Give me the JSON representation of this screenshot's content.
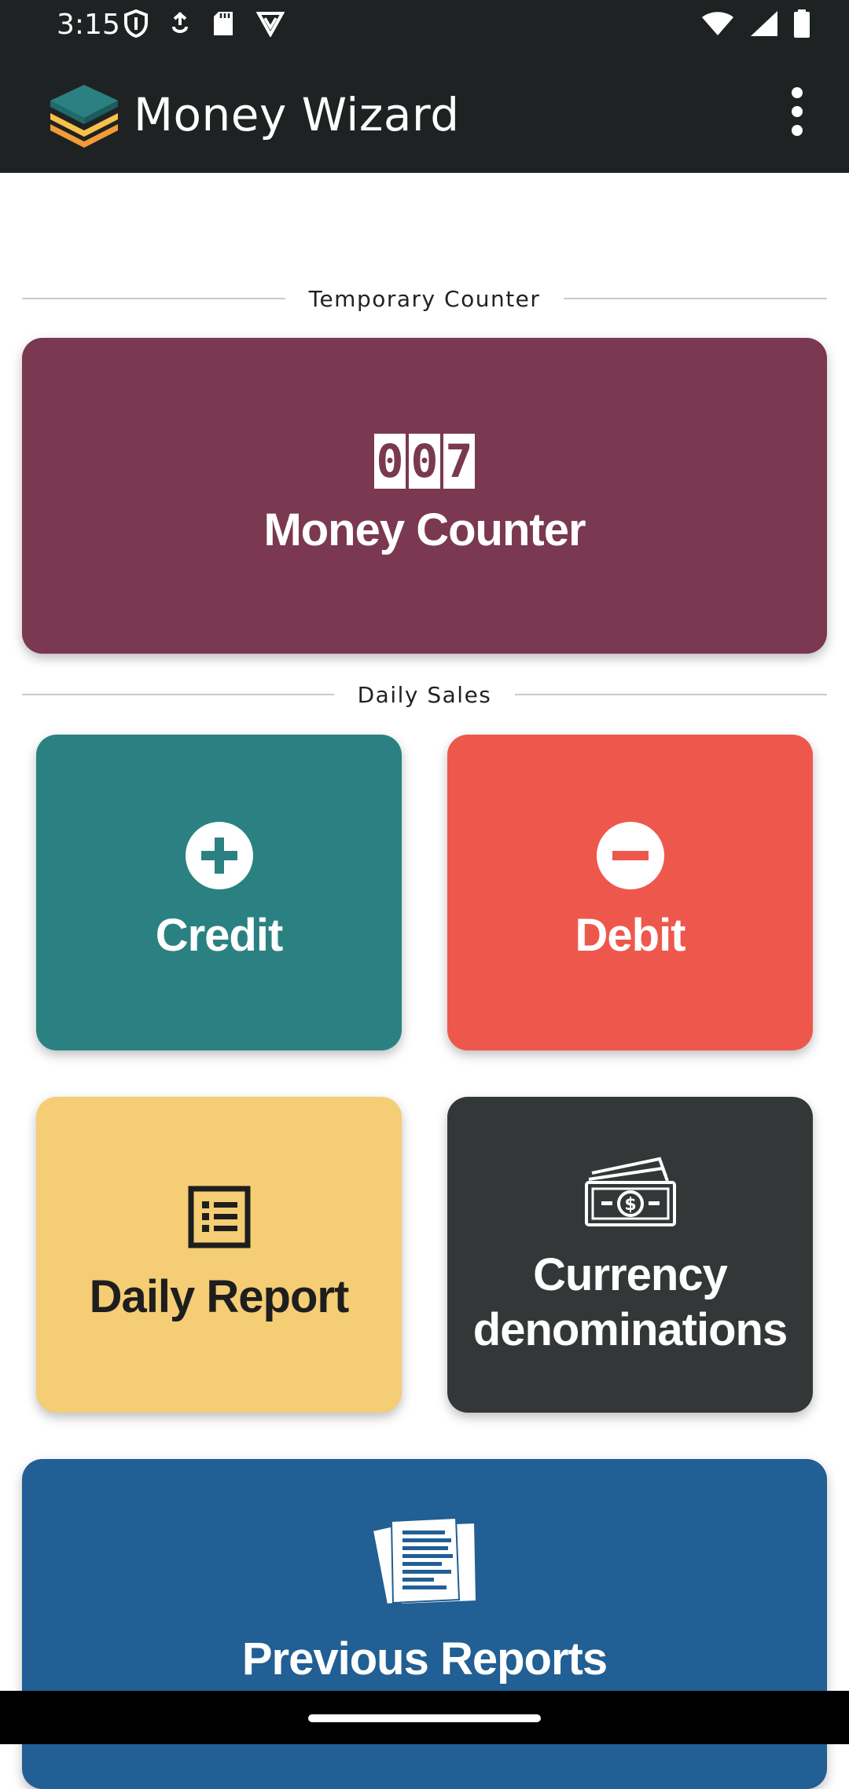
{
  "status_bar": {
    "time": "3:15",
    "left_icons": [
      "shield-icon",
      "usb-debug-icon",
      "sd-card-icon",
      "vpn-badge-icon"
    ],
    "right_icons": [
      "wifi-icon",
      "cellular-signal-icon",
      "battery-icon"
    ]
  },
  "app_bar": {
    "title": "Money Wizard",
    "logo_icon": "stacked-layers-logo",
    "menu_icon": "overflow-menu-icon"
  },
  "sections": {
    "temporary_counter": "Temporary Counter",
    "daily_sales": "Daily Sales"
  },
  "cards": {
    "money_counter": {
      "label": "Money Counter",
      "icon": "counter-digits-icon",
      "digits": [
        "0",
        "0",
        "7"
      ],
      "color": "#7a3851"
    },
    "credit": {
      "label": "Credit",
      "icon": "plus-circle-icon",
      "color": "#2b8181"
    },
    "debit": {
      "label": "Debit",
      "icon": "minus-circle-icon",
      "color": "#ee584c"
    },
    "daily_report": {
      "label": "Daily Report",
      "icon": "list-report-icon",
      "color": "#f4cd74"
    },
    "currency": {
      "label_line1": "Currency",
      "label_line2": "denominations",
      "icon": "banknotes-icon",
      "color": "#343738"
    },
    "previous_reports": {
      "label": "Previous Reports",
      "icon": "documents-icon",
      "color": "#215f94"
    }
  },
  "theme": {
    "app_bar_bg": "#1f2223",
    "accent_orange": "#f29b38",
    "accent_teal": "#2b8181"
  }
}
